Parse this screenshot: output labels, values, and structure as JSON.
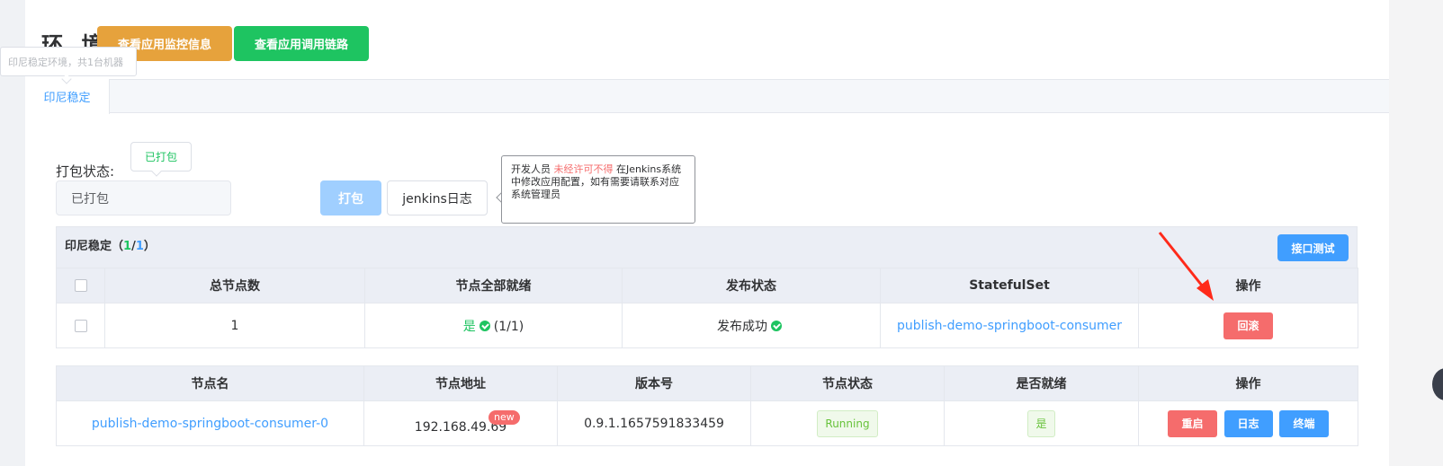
{
  "header": {
    "title": "环 境",
    "monitor_button": "查看应用监控信息",
    "trace_button": "查看应用调用链路",
    "env_tooltip": "印尼稳定环境，共1台机器"
  },
  "tabs": [
    {
      "label": "印尼稳定",
      "active": true
    }
  ],
  "pack": {
    "label": "打包状态:",
    "tooltip": "已打包",
    "value": "已打包",
    "pack_button": "打包",
    "jenkins_button": "jenkins日志"
  },
  "warning": {
    "prefix": "开发人员",
    "emphasis": "未经许可不得",
    "suffix": "在Jenkins系统中修改应用配置，如有需要请联系对应系统管理员"
  },
  "group": {
    "name": "印尼稳定",
    "paren_open": "（",
    "ready": "1",
    "slash": "/",
    "total": "1",
    "paren_close": "）",
    "api_test_button": "接口测试"
  },
  "summary_table": {
    "headers": [
      "总节点数",
      "节点全部就绪",
      "发布状态",
      "StatefulSet",
      "操作"
    ],
    "row": {
      "total_nodes": "1",
      "all_ready": "是",
      "ready_ratio": "(1/1)",
      "publish_status": "发布成功",
      "statefulset": "publish-demo-springboot-consumer",
      "rollback_button": "回滚"
    }
  },
  "node_table": {
    "headers": [
      "节点名",
      "节点地址",
      "版本号",
      "节点状态",
      "是否就绪",
      "操作"
    ],
    "rows": [
      {
        "name": "publish-demo-springboot-consumer-0",
        "address": "192.168.49.69",
        "badge": "new",
        "version": "0.9.1.1657591833459",
        "status": "Running",
        "ready": "是",
        "restart_button": "重启",
        "log_button": "日志",
        "terminal_button": "终端"
      }
    ]
  },
  "colors": {
    "primary": "#409eff",
    "success": "#1ec461",
    "warning": "#e6a23c",
    "danger": "#f56c6c"
  }
}
